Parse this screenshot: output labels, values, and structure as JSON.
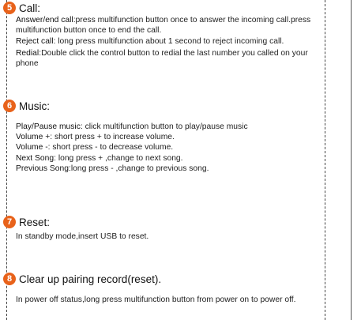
{
  "sections": [
    {
      "number": "5",
      "title": "Call:",
      "items": [
        {
          "label": "Answer/end call",
          "text": ":press multifunction button once to answer the incoming call.press multifunction button once to end the call."
        },
        {
          "label": "Reject call",
          "text": ": long press multifunction about 1 second to reject incoming call."
        },
        {
          "label": "Redial",
          "text": ":Double click the control button to redial the last number you called on your phone"
        }
      ]
    },
    {
      "number": "6",
      "title": "Music:",
      "items": [
        {
          "label": "Play/Pause music",
          "text": ": click multifunction button to play/pause music"
        },
        {
          "label": "Volume +",
          "text": ": short press + to increase volume."
        },
        {
          "label": "Volume -",
          "text": ": short press - to decrease volume."
        },
        {
          "label": "Next Song",
          "text": ": long press + ,change to next song."
        },
        {
          "label": "Previous Song",
          "text": ":long press - ,change to previous song."
        }
      ]
    },
    {
      "number": "7",
      "title": "Reset:",
      "text": "In standby mode,insert USB to reset."
    },
    {
      "number": "8",
      "title": "Clear up pairing record(reset).",
      "text": "In power off status,long press multifunction button from power on to power off."
    }
  ],
  "colors": {
    "badge": "#e8621a"
  }
}
